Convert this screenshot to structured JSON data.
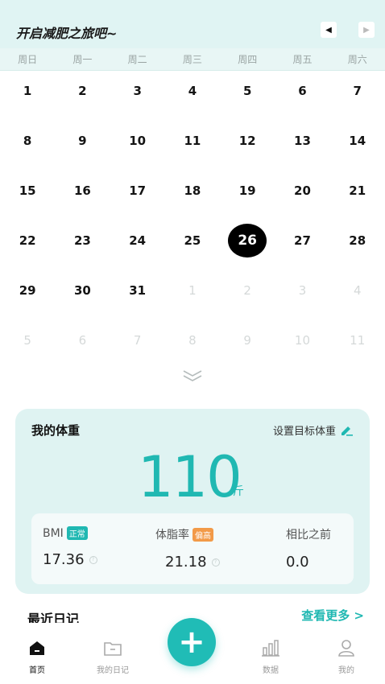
{
  "header": {
    "title": "开启减肥之旅吧~"
  },
  "weekdays": [
    "周日",
    "周一",
    "周二",
    "周三",
    "周四",
    "周五",
    "周六"
  ],
  "calendar": {
    "rows": [
      [
        {
          "d": "1"
        },
        {
          "d": "2"
        },
        {
          "d": "3"
        },
        {
          "d": "4"
        },
        {
          "d": "5"
        },
        {
          "d": "6"
        },
        {
          "d": "7"
        }
      ],
      [
        {
          "d": "8"
        },
        {
          "d": "9"
        },
        {
          "d": "10"
        },
        {
          "d": "11"
        },
        {
          "d": "12"
        },
        {
          "d": "13"
        },
        {
          "d": "14"
        }
      ],
      [
        {
          "d": "15"
        },
        {
          "d": "16"
        },
        {
          "d": "17"
        },
        {
          "d": "18"
        },
        {
          "d": "19"
        },
        {
          "d": "20"
        },
        {
          "d": "21"
        }
      ],
      [
        {
          "d": "22"
        },
        {
          "d": "23"
        },
        {
          "d": "24"
        },
        {
          "d": "25"
        },
        {
          "d": "26",
          "today": true
        },
        {
          "d": "27"
        },
        {
          "d": "28"
        }
      ],
      [
        {
          "d": "29"
        },
        {
          "d": "30"
        },
        {
          "d": "31"
        },
        {
          "d": "1",
          "muted": true
        },
        {
          "d": "2",
          "muted": true
        },
        {
          "d": "3",
          "muted": true
        },
        {
          "d": "4",
          "muted": true
        }
      ],
      [
        {
          "d": "5",
          "muted": true
        },
        {
          "d": "6",
          "muted": true
        },
        {
          "d": "7",
          "muted": true
        },
        {
          "d": "8",
          "muted": true
        },
        {
          "d": "9",
          "muted": true
        },
        {
          "d": "10",
          "muted": true
        },
        {
          "d": "11",
          "muted": true
        }
      ]
    ]
  },
  "weight": {
    "title": "我的体重",
    "target_label": "设置目标体重",
    "value": "110",
    "unit": "斤",
    "stats": {
      "bmi_label": "BMI",
      "bmi_badge": "正常",
      "bmi_value": "17.36",
      "fat_label": "体脂率",
      "fat_badge": "偏高",
      "fat_value": "21.18",
      "compare_label": "相比之前",
      "compare_value": "0.0"
    }
  },
  "recent": {
    "title": "最近日记",
    "see_more": "查看更多 >"
  },
  "tabbar": {
    "home": "首页",
    "diary": "我的日记",
    "data": "数据",
    "mine": "我的"
  },
  "colors": {
    "accent": "#20b8b2",
    "badge_high": "#f29a48",
    "card_bg": "#dff3f2"
  }
}
